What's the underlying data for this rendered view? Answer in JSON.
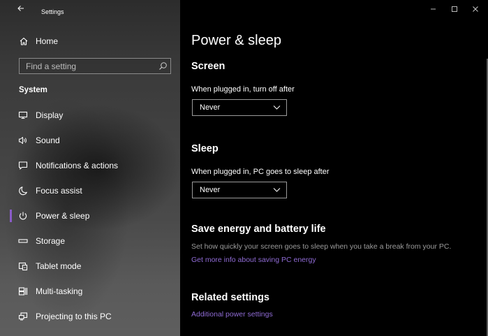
{
  "window": {
    "title": "Settings"
  },
  "sidebar": {
    "home_label": "Home",
    "search": {
      "placeholder": "Find a setting",
      "value": ""
    },
    "section_title": "System",
    "items": [
      {
        "label": "Display",
        "icon": "monitor-icon",
        "selected": false
      },
      {
        "label": "Sound",
        "icon": "speaker-icon",
        "selected": false
      },
      {
        "label": "Notifications & actions",
        "icon": "notification-icon",
        "selected": false
      },
      {
        "label": "Focus assist",
        "icon": "moon-icon",
        "selected": false
      },
      {
        "label": "Power & sleep",
        "icon": "power-icon",
        "selected": true
      },
      {
        "label": "Storage",
        "icon": "storage-icon",
        "selected": false
      },
      {
        "label": "Tablet mode",
        "icon": "tablet-mode-icon",
        "selected": false
      },
      {
        "label": "Multi-tasking",
        "icon": "multitasking-icon",
        "selected": false
      },
      {
        "label": "Projecting to this PC",
        "icon": "projecting-icon",
        "selected": false
      }
    ]
  },
  "main": {
    "page_title": "Power & sleep",
    "screen": {
      "heading": "Screen",
      "label": "When plugged in, turn off after",
      "value": "Never"
    },
    "sleep": {
      "heading": "Sleep",
      "label": "When plugged in, PC goes to sleep after",
      "value": "Never"
    },
    "save_energy": {
      "heading": "Save energy and battery life",
      "description": "Set how quickly your screen goes to sleep when you take a break from your PC.",
      "link": "Get more info about saving PC energy"
    },
    "related": {
      "heading": "Related settings",
      "link": "Additional power settings"
    }
  },
  "colors": {
    "accent": "#8b5cc9",
    "link": "#8f6bd4",
    "content_bg": "#000000",
    "description_text": "#9b9b9b"
  }
}
